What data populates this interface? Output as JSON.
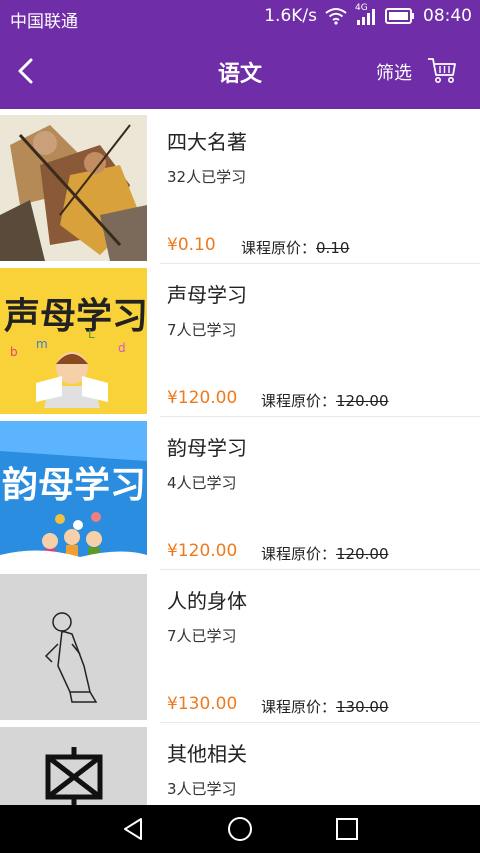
{
  "status": {
    "carrier": "中国联通",
    "speed": "1.6K/s",
    "network": "4G",
    "time": "08:40"
  },
  "header": {
    "title": "语文",
    "filter_label": "筛选"
  },
  "courses": [
    {
      "name": "四大名著",
      "learners": "32人已学习",
      "price": "¥0.10",
      "orig_label": "课程原价：",
      "orig_value": "0.10",
      "thumb_text": ""
    },
    {
      "name": "声母学习",
      "learners": "7人已学习",
      "price": "¥120.00",
      "orig_label": "课程原价：",
      "orig_value": "120.00",
      "thumb_text": "声母学习"
    },
    {
      "name": "韵母学习",
      "learners": "4人已学习",
      "price": "¥120.00",
      "orig_label": "课程原价：",
      "orig_value": "120.00",
      "thumb_text": "韵母学习"
    },
    {
      "name": "人的身体",
      "learners": "7人已学习",
      "price": "¥130.00",
      "orig_label": "课程原价：",
      "orig_value": "130.00",
      "thumb_text": ""
    },
    {
      "name": "其他相关",
      "learners": "3人已学习",
      "price": "",
      "orig_label": "",
      "orig_value": "",
      "thumb_text": ""
    }
  ],
  "colors": {
    "primary": "#6f2da8",
    "price": "#ee7a1e"
  },
  "icons": {
    "back": "chevron-left-icon",
    "cart": "shopping-cart-icon",
    "nav": [
      "back-triangle-icon",
      "home-circle-icon",
      "recents-square-icon"
    ]
  }
}
